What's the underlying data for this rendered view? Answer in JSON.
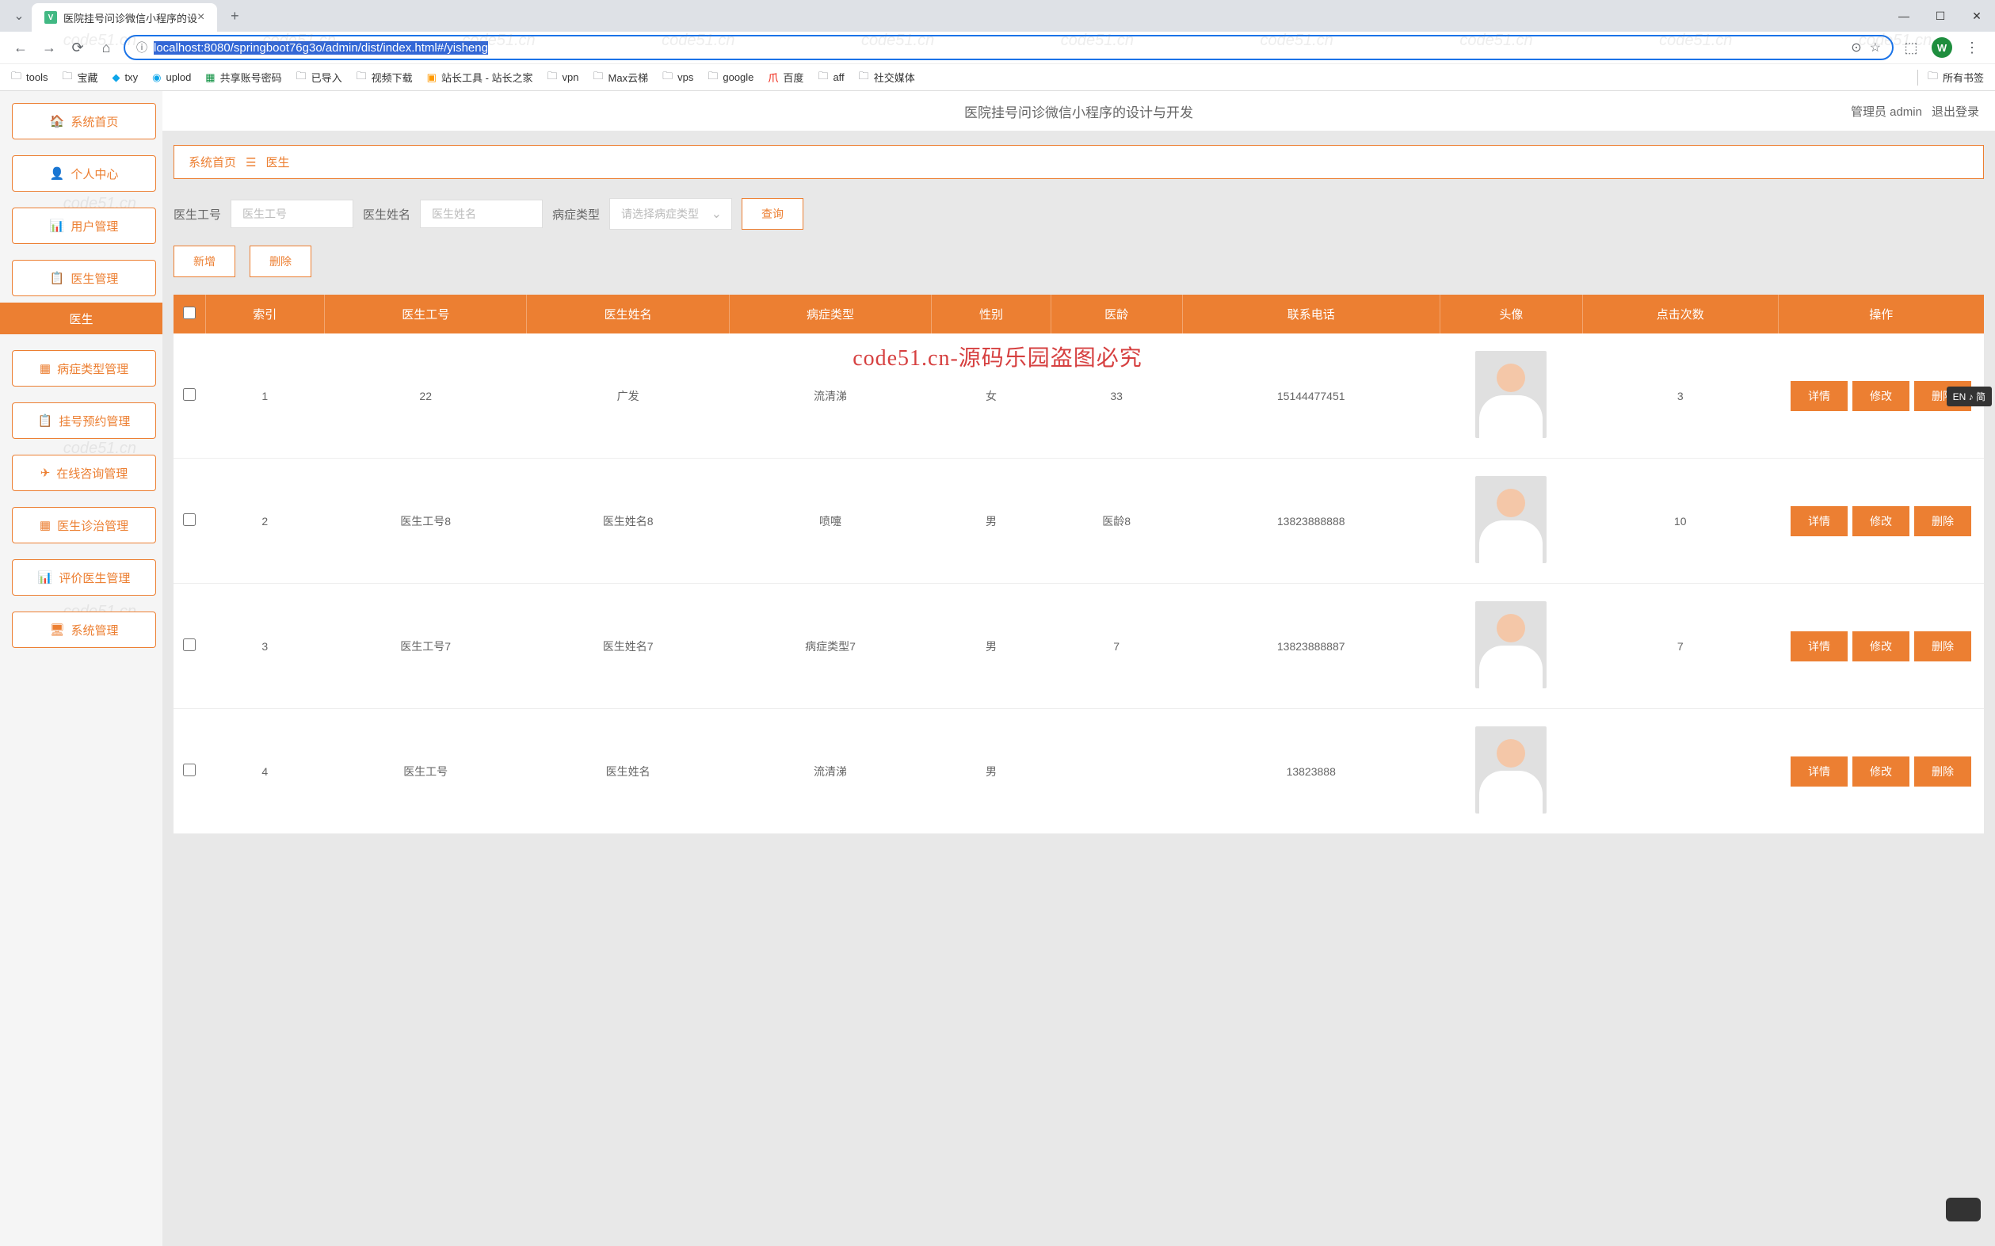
{
  "browser": {
    "tab_title": "医院挂号问诊微信小程序的设",
    "url_display": "localhost:8080/springboot76g3o/admin/dist/index.html#/yisheng",
    "profile_letter": "W"
  },
  "bookmarks": {
    "items": [
      "tools",
      "宝藏",
      "txy",
      "uplod",
      "共享账号密码",
      "已导入",
      "视频下载",
      "站长工具 - 站长之家",
      "vpn",
      "Max云梯",
      "vps",
      "google",
      "百度",
      "aff",
      "社交媒体"
    ],
    "all": "所有书签"
  },
  "sidebar": {
    "items": [
      {
        "label": "系统首页",
        "icon": "🏠"
      },
      {
        "label": "个人中心",
        "icon": "👤"
      },
      {
        "label": "用户管理",
        "icon": "📊"
      },
      {
        "label": "医生管理",
        "icon": "📋"
      },
      {
        "label": "病症类型管理",
        "icon": "▦"
      },
      {
        "label": "挂号预约管理",
        "icon": "📋"
      },
      {
        "label": "在线咨询管理",
        "icon": "✈"
      },
      {
        "label": "医生诊治管理",
        "icon": "▦"
      },
      {
        "label": "评价医生管理",
        "icon": "📊"
      },
      {
        "label": "系统管理",
        "icon": "🖥"
      }
    ],
    "submenu": "医生"
  },
  "header": {
    "title": "医院挂号问诊微信小程序的设计与开发",
    "role": "管理员 admin",
    "logout": "退出登录"
  },
  "breadcrumb": {
    "home": "系统首页",
    "current": "医生"
  },
  "filters": {
    "lbl_id": "医生工号",
    "ph_id": "医生工号",
    "lbl_name": "医生姓名",
    "ph_name": "医生姓名",
    "lbl_type": "病症类型",
    "ph_type": "请选择病症类型",
    "search": "查询",
    "add": "新增",
    "del": "删除"
  },
  "table": {
    "headers": [
      "",
      "索引",
      "医生工号",
      "医生姓名",
      "病症类型",
      "性别",
      "医龄",
      "联系电话",
      "头像",
      "点击次数",
      "操作"
    ],
    "actions": {
      "detail": "详情",
      "edit": "修改",
      "delete": "删除"
    },
    "rows": [
      {
        "idx": "1",
        "id": "22",
        "name": "广发",
        "type": "流清涕",
        "gender": "女",
        "age": "33",
        "phone": "15144477451",
        "clicks": "3"
      },
      {
        "idx": "2",
        "id": "医生工号8",
        "name": "医生姓名8",
        "type": "喷嚏",
        "gender": "男",
        "age": "医龄8",
        "phone": "13823888888",
        "clicks": "10"
      },
      {
        "idx": "3",
        "id": "医生工号7",
        "name": "医生姓名7",
        "type": "病症类型7",
        "gender": "男",
        "age": "7",
        "phone": "13823888887",
        "clicks": "7"
      },
      {
        "idx": "4",
        "id": "医生工号",
        "name": "医生姓名",
        "type": "流清涕",
        "gender": "男",
        "age": "",
        "phone": "13823888",
        "clicks": ""
      }
    ]
  },
  "big_watermark": "code51.cn-源码乐园盗图必究",
  "watermark": "code51.cn",
  "ime": "EN ♪ 简"
}
